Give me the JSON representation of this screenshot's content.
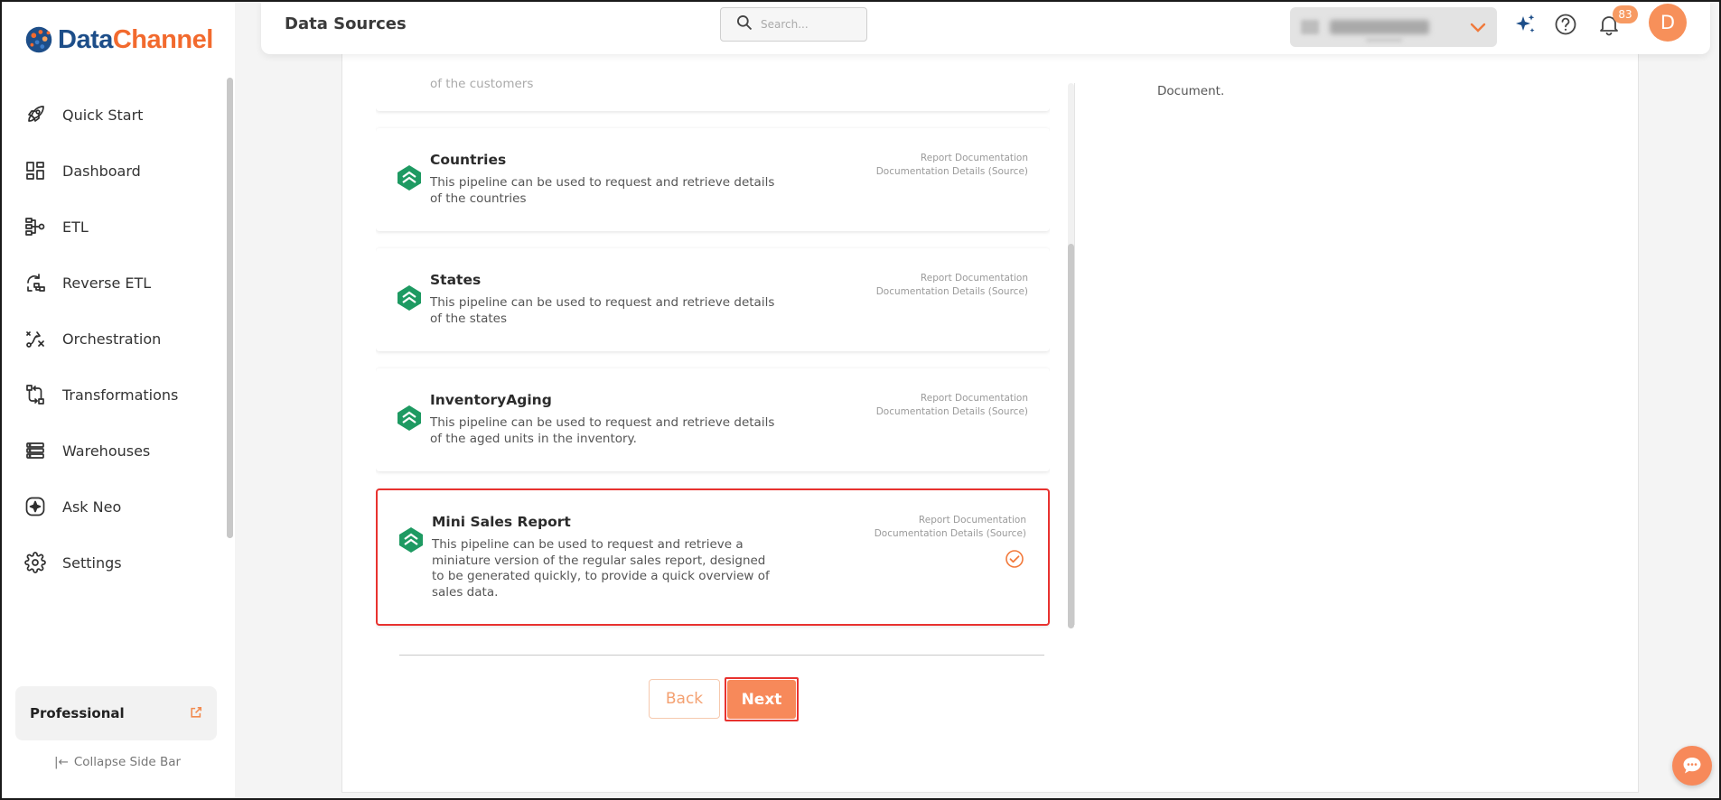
{
  "brand": {
    "name_part1": "Data",
    "name_part2": "Channel"
  },
  "header": {
    "title": "Data Sources",
    "search_placeholder": "Search...",
    "notification_count": "83",
    "avatar_initial": "D"
  },
  "sidebar": {
    "items": [
      {
        "label": "Quick Start",
        "icon": "rocket-icon"
      },
      {
        "label": "Dashboard",
        "icon": "dashboard-icon"
      },
      {
        "label": "ETL",
        "icon": "etl-icon"
      },
      {
        "label": "Reverse ETL",
        "icon": "reverse-etl-icon"
      },
      {
        "label": "Orchestration",
        "icon": "orchestration-icon"
      },
      {
        "label": "Transformations",
        "icon": "transformations-icon"
      },
      {
        "label": "Warehouses",
        "icon": "warehouses-icon"
      },
      {
        "label": "Ask Neo",
        "icon": "sparkle-icon"
      },
      {
        "label": "Settings",
        "icon": "gear-icon"
      }
    ],
    "plan": "Professional",
    "collapse_label": "Collapse Side Bar"
  },
  "right_panel": {
    "text": "Document."
  },
  "pipelines": [
    {
      "name": "Countries",
      "description": "This pipeline can be used to request and retrieve details of the countries",
      "link1": "Report Documentation",
      "link2": "Documentation Details (Source)",
      "selected": false
    },
    {
      "name": "States",
      "description": "This pipeline can be used to request and retrieve details of the states",
      "link1": "Report Documentation",
      "link2": "Documentation Details (Source)",
      "selected": false
    },
    {
      "name": "InventoryAging",
      "description": "This pipeline can be used to request and retrieve details of the aged units in the inventory.",
      "link1": "Report Documentation",
      "link2": "Documentation Details (Source)",
      "selected": false
    },
    {
      "name": "Mini Sales Report",
      "description": "This pipeline can be used to request and retrieve a miniature version of the regular sales report, designed to be generated quickly, to provide a quick overview of sales data.",
      "link1": "Report Documentation",
      "link2": "Documentation Details (Source)",
      "selected": true
    }
  ],
  "previous_card_tail": "of the customers",
  "buttons": {
    "back": "Back",
    "next": "Next"
  },
  "colors": {
    "accent": "#f7895a",
    "selection": "#e8322f",
    "brand_blue": "#1d4e89",
    "pipeline_green": "#1e9a62"
  }
}
